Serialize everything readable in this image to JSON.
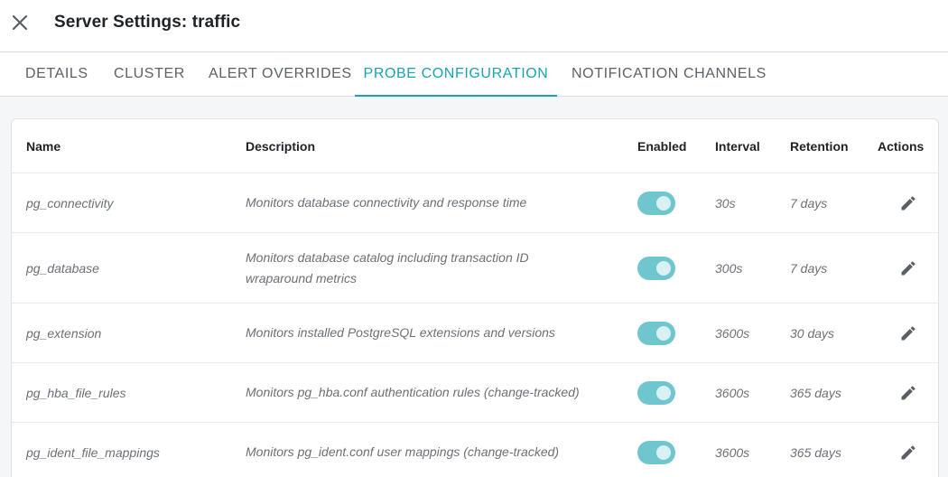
{
  "header": {
    "title": "Server Settings: traffic"
  },
  "tabs": [
    {
      "label": "DETAILS",
      "active": false
    },
    {
      "label": "CLUSTER",
      "active": false
    },
    {
      "label": "ALERT OVERRIDES",
      "active": false
    },
    {
      "label": "PROBE CONFIGURATION",
      "active": true
    },
    {
      "label": "NOTIFICATION CHANNELS",
      "active": false
    }
  ],
  "table": {
    "columns": {
      "name": "Name",
      "description": "Description",
      "enabled": "Enabled",
      "interval": "Interval",
      "retention": "Retention",
      "actions": "Actions"
    },
    "rows": [
      {
        "name": "pg_connectivity",
        "description": "Monitors database connectivity and response time",
        "enabled": true,
        "interval": "30s",
        "retention": "7 days"
      },
      {
        "name": "pg_database",
        "description": "Monitors database catalog including transaction ID wraparound metrics",
        "enabled": true,
        "interval": "300s",
        "retention": "7 days"
      },
      {
        "name": "pg_extension",
        "description": "Monitors installed PostgreSQL extensions and versions",
        "enabled": true,
        "interval": "3600s",
        "retention": "30 days"
      },
      {
        "name": "pg_hba_file_rules",
        "description": "Monitors pg_hba.conf authentication rules (change-tracked)",
        "enabled": true,
        "interval": "3600s",
        "retention": "365 days"
      },
      {
        "name": "pg_ident_file_mappings",
        "description": "Monitors pg_ident.conf user mappings (change-tracked)",
        "enabled": true,
        "interval": "3600s",
        "retention": "365 days"
      }
    ]
  },
  "icons": {
    "close": "close-icon",
    "edit": "pencil-icon"
  },
  "colors": {
    "accent": "#1aa2b3",
    "toggle_on": "#6fc6cf",
    "toggle_knob": "#d8f1f3",
    "icon": "#5a5f66"
  }
}
